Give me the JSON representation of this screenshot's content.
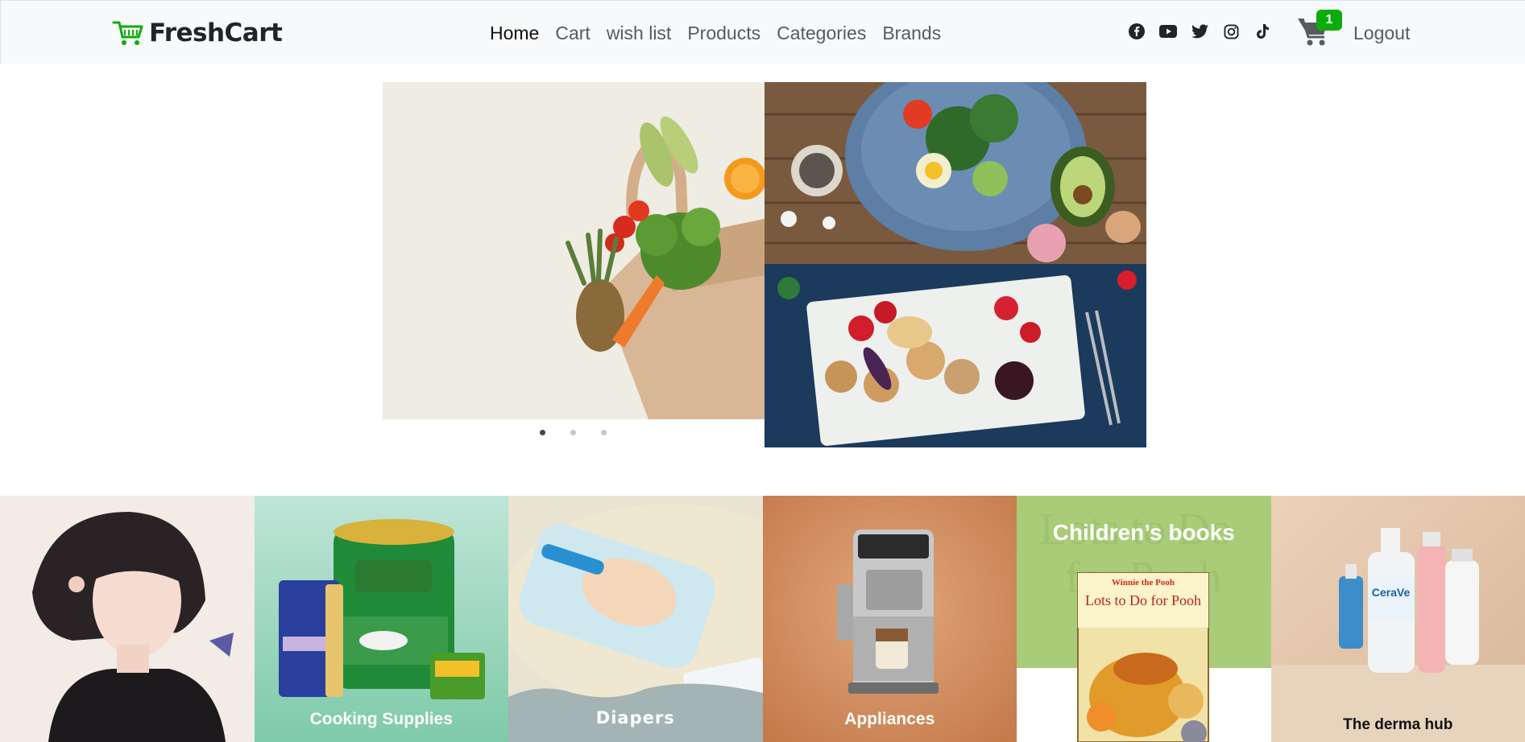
{
  "navbar": {
    "brand": "FreshCart",
    "links": [
      "Home",
      "Cart",
      "wish list",
      "Products",
      "Categories",
      "Brands"
    ],
    "social_icons": [
      "facebook-icon",
      "youtube-icon",
      "twitter-icon",
      "instagram-icon",
      "tiktok-icon"
    ],
    "cart_count": "1",
    "logout": "Logout"
  },
  "slider": {
    "active_index": 0,
    "slides": 3
  },
  "categories": [
    {
      "label": ""
    },
    {
      "label": "Cooking Supplies"
    },
    {
      "label": "Diapers"
    },
    {
      "label": "Appliances"
    },
    {
      "label": "Children’s books",
      "book_title": "Lots to Do for Pooh",
      "book_brand": "Winnie the Pooh"
    },
    {
      "label": "The derma hub",
      "product_text": "CeraVe"
    }
  ],
  "colors": {
    "brand_green": "#0aad0a",
    "navbar_bg": "#f8f9fa"
  }
}
